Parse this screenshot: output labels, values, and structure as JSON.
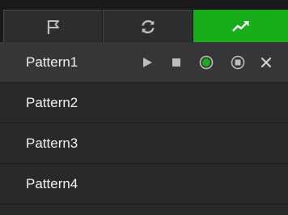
{
  "tabs": [
    {
      "icon": "flag-icon",
      "active": false
    },
    {
      "icon": "refresh-icon",
      "active": false
    },
    {
      "icon": "trend-up-icon",
      "active": true
    }
  ],
  "colors": {
    "active_tab": "#1aad1a",
    "icon_gray": "#bdbdbd",
    "record_green": "#1aad1a",
    "text": "#f2f2f2"
  },
  "patterns": [
    {
      "label": "Pattern1",
      "selected": true
    },
    {
      "label": "Pattern2",
      "selected": false
    },
    {
      "label": "Pattern3",
      "selected": false
    },
    {
      "label": "Pattern4",
      "selected": false
    }
  ],
  "row_controls": [
    "play-icon",
    "stop-icon",
    "record-icon",
    "stop-record-icon",
    "delete-icon"
  ]
}
